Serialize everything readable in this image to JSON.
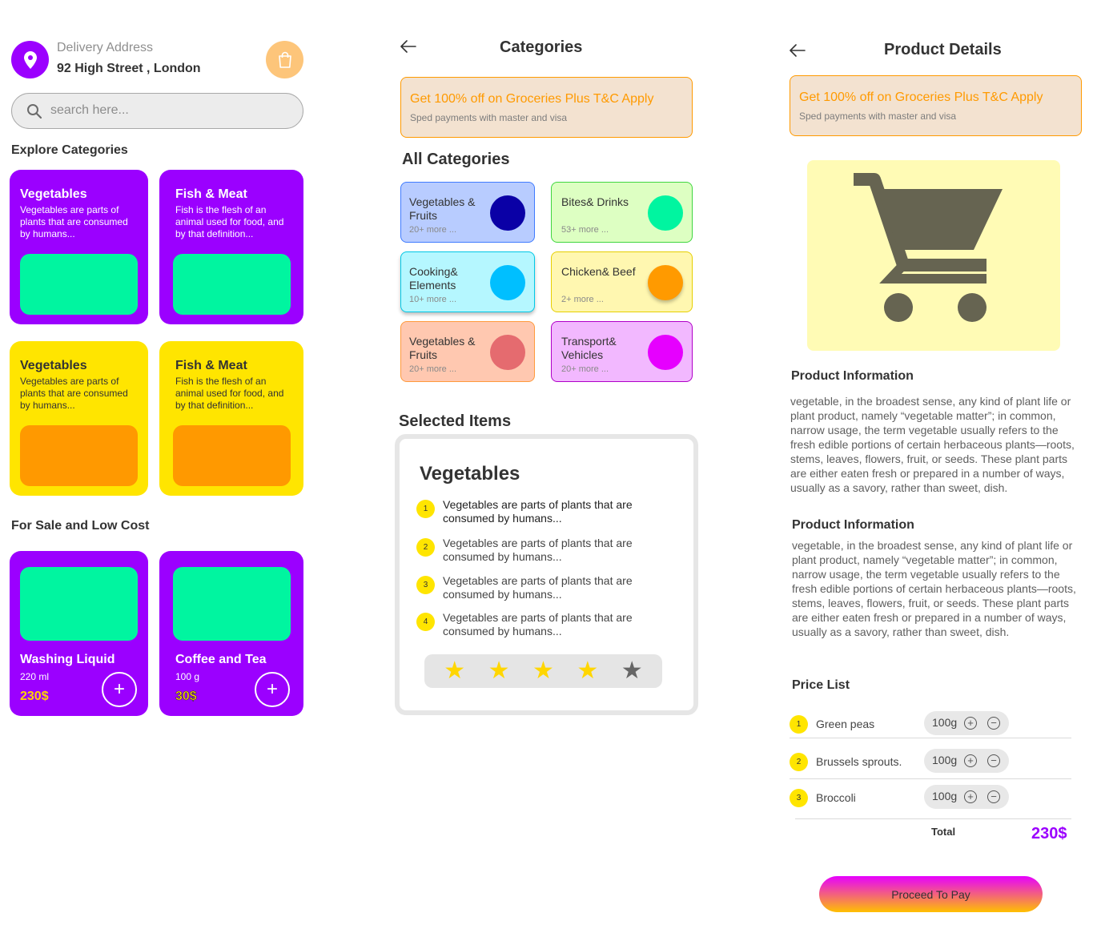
{
  "home": {
    "delivery_label": "Delivery Address",
    "delivery_address": "92 High Street , London",
    "search_placeholder": "search here...",
    "explore_title": "Explore Categories",
    "explore_cards": [
      {
        "title": "Vegetables",
        "desc": "Vegetables are parts of plants that are consumed by humans...",
        "color": "purple"
      },
      {
        "title": "Fish & Meat",
        "desc": "Fish is the flesh of an animal used for food, and by that definition...",
        "color": "purple"
      },
      {
        "title": "Vegetables",
        "desc": "Vegetables are parts of plants that are consumed by humans...",
        "color": "yellow"
      },
      {
        "title": "Fish & Meat",
        "desc": "Fish is the flesh of an animal used for food, and by that definition...",
        "color": "yellow"
      }
    ],
    "sale_title": "For Sale and Low Cost",
    "sale_cards": [
      {
        "title": "Washing Liquid",
        "qty": "220 ml",
        "price": "230$"
      },
      {
        "title": "Coffee and Tea",
        "qty": "100 g",
        "price": "30$"
      }
    ]
  },
  "categories": {
    "title": "Categories",
    "promo_heading": "Get 100% off on Groceries Plus T&C Apply",
    "promo_sub": "Sped payments with master and visa",
    "all_title": "All Categories",
    "items": [
      {
        "name": "Vegetables & Fruits",
        "more": "20+ more ...",
        "bg": "#B8CCFF",
        "border": "#3F7BFF",
        "dot": "#0A00A6"
      },
      {
        "name": "Bites& Drinks",
        "more": "53+ more ...",
        "bg": "#DDFFC2",
        "border": "#3FD63F",
        "dot": "#00F5A0"
      },
      {
        "name": "Cooking& Elements",
        "more": "10+ more ...",
        "bg": "#B5F7FF",
        "border": "#00C8E6",
        "dot": "#00BFFF"
      },
      {
        "name": "Chicken& Beef",
        "more": "2+ more ...",
        "bg": "#FFF7B0",
        "border": "#E6CF00",
        "dot": "#FF9A00"
      },
      {
        "name": "Vegetables & Fruits",
        "more": "20+ more ...",
        "bg": "#FFC8B0",
        "border": "#FF9A3C",
        "dot": "#E56B6F"
      },
      {
        "name": "Transport& Vehicles",
        "more": "20+ more ...",
        "bg": "#F2B8FF",
        "border": "#B000C8",
        "dot": "#E600FF"
      }
    ],
    "selected_title": "Selected Items",
    "selected_heading": "Vegetables",
    "selected_list": [
      {
        "n": "1",
        "text": "Vegetables are parts of plants that are consumed by humans..."
      },
      {
        "n": "2",
        "text": "Vegetables are parts of plants that are consumed by humans..."
      },
      {
        "n": "3",
        "text": "Vegetables are parts of plants that are consumed by humans..."
      },
      {
        "n": "4",
        "text": "Vegetables are parts of plants that are consumed by humans..."
      }
    ],
    "rating": {
      "value": 4,
      "max": 5
    }
  },
  "product": {
    "title": "Product Details",
    "promo_heading": "Get 100% off on Groceries Plus T&C Apply",
    "promo_sub": "Sped payments with master and visa",
    "info_title_1": "Product Information",
    "info_text_1": "vegetable,  in the broadest sense, any kind of plant life or plant product, namely “vegetable matter”; in common, narrow usage, the term vegetable usually refers to the fresh edible portions of certain herbaceous plants—roots, stems, leaves, flowers, fruit, or seeds. These plant parts are either eaten fresh or prepared in a number of ways, usually as a savory, rather than sweet, dish.",
    "info_title_2": "Product Information",
    "info_text_2": "vegetable,  in the broadest sense, any kind of plant life or plant product, namely “vegetable matter”; in common, narrow usage, the term vegetable usually refers to the fresh edible portions of certain herbaceous plants—roots, stems, leaves, flowers, fruit, or seeds. These plant parts are either eaten fresh or prepared in a number of ways, usually as a savory, rather than sweet, dish.",
    "price_title": "Price List",
    "price_list": [
      {
        "n": "1",
        "name": "Green peas",
        "qty": "100g"
      },
      {
        "n": "2",
        "name": "Brussels sprouts.",
        "qty": "100g"
      },
      {
        "n": "3",
        "name": "Broccoli",
        "qty": "100g"
      }
    ],
    "total_label": "Total",
    "total_value": "230$",
    "pay_label": "Proceed To Pay"
  },
  "colors": {
    "purple": "#9B00FF",
    "yellow": "#FFE500",
    "green": "#00F5A0",
    "orange": "#FF9900"
  },
  "icons": [
    "location-pin-icon",
    "shopping-bag-icon",
    "search-icon",
    "back-arrow-icon",
    "plus-icon",
    "minus-icon",
    "star-icon",
    "shopping-cart-icon"
  ]
}
